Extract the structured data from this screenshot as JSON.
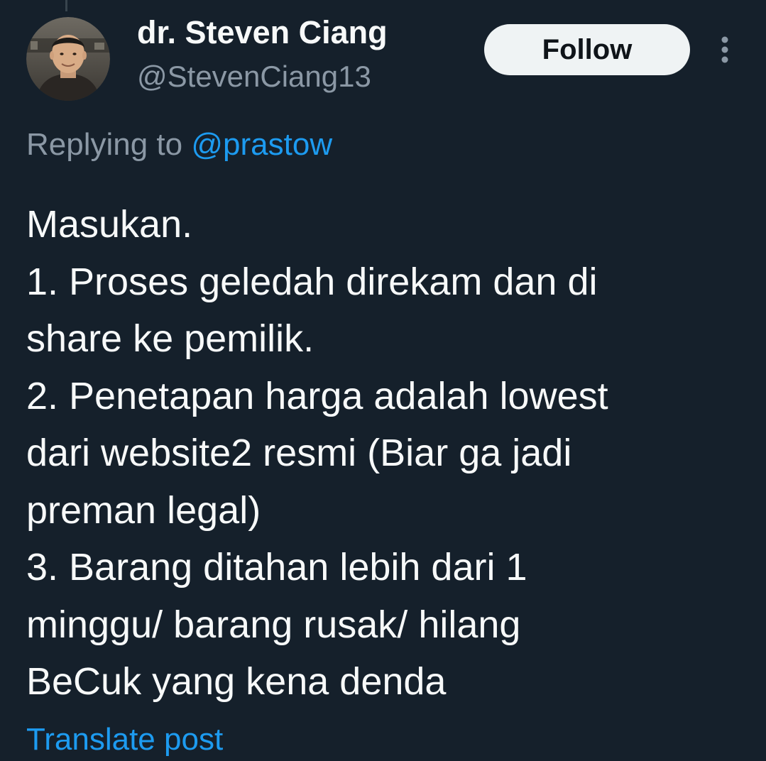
{
  "author": {
    "display_name": "dr. Steven Ciang",
    "handle": "@StevenCiang13",
    "avatar_icon": "profile-photo"
  },
  "header": {
    "follow_label": "Follow",
    "more_icon": "vertical-ellipsis-icon"
  },
  "reply": {
    "prefix": "Replying to ",
    "mention": "@prastow"
  },
  "post": {
    "lines": [
      "Masukan.",
      "1. Proses geledah direkam dan di",
      "share ke pemilik.",
      "2. Penetapan harga adalah lowest",
      "dari website2 resmi (Biar ga jadi",
      "preman legal)",
      "3. Barang ditahan lebih dari 1",
      "minggu/ barang rusak/ hilang",
      "BeCuk yang kena denda"
    ]
  },
  "footer": {
    "translate_label": "Translate post"
  },
  "colors": {
    "background": "#15202b",
    "primary_text": "#f7f9f9",
    "secondary_text": "#8b98a5",
    "accent_blue": "#1d9bf0",
    "follow_button_bg": "#eff3f4"
  }
}
